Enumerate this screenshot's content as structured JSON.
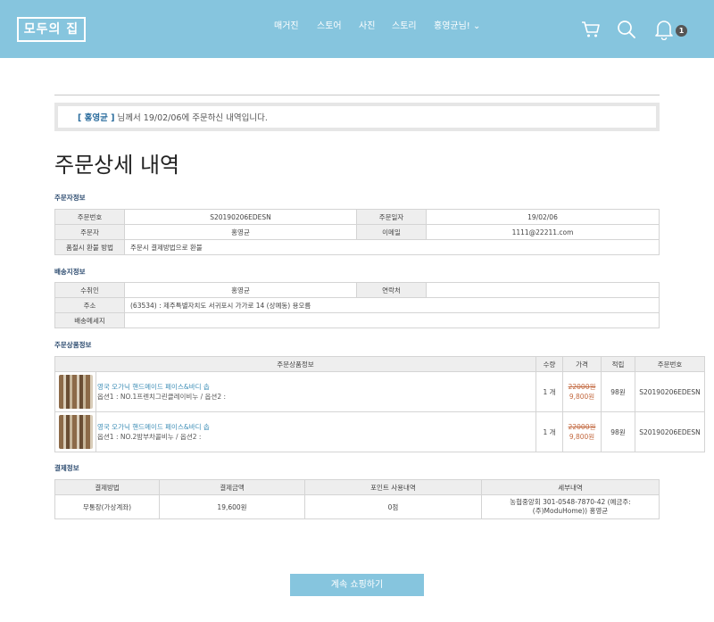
{
  "header": {
    "logo": "모두의 집",
    "nav": [
      "매거진",
      "스토어",
      "사진",
      "스토리",
      "홍영균님! ⌄"
    ],
    "notification_count": "1",
    "icons": [
      "cart-icon",
      "search-icon",
      "bell-icon"
    ]
  },
  "notice": {
    "name": "[ 홍영균 ]",
    "text": " 님께서 19/02/06에 주문하신 내역입니다."
  },
  "page_title": "주문상세 내역",
  "orderer": {
    "section": "주문자정보",
    "order_no_label": "주문번호",
    "order_no": "S20190206EDESN",
    "order_date_label": "주문일자",
    "order_date": "19/02/06",
    "orderer_label": "주문자",
    "orderer": "홍영균",
    "email_label": "이메일",
    "email": "1111@22211.com",
    "refund_label": "품절시 환불 방법",
    "refund": "주문시 결제방법으로 환불"
  },
  "shipping": {
    "section": "배송지정보",
    "recipient_label": "수취인",
    "recipient": "홍영균",
    "contact_label": "연락처",
    "contact": "",
    "address_label": "주소",
    "address": "(63534) : 제주특별자치도 서귀포시 가가로 14 (상예동) 용오름",
    "message_label": "배송메세지",
    "message": ""
  },
  "products": {
    "section": "주문상품정보",
    "headers": [
      "주문상품정보",
      "수량",
      "가격",
      "적립",
      "주문번호"
    ],
    "rows": [
      {
        "name": "영국 오가닉 핸드메이드 페이스&바디 솝",
        "option": "옵션1 : NO.1프렌치그린클레이비누 / 옵션2 :",
        "qty": "1 개",
        "orig_price": "22000원",
        "price": "9,800원",
        "points": "98원",
        "order_no": "S20190206EDESN"
      },
      {
        "name": "영국 오가닉 핸드메이드 페이스&바디 솝",
        "option": "옵션1 : NO.2밤부차콜비누 / 옵션2 :",
        "qty": "1 개",
        "orig_price": "22000원",
        "price": "9,800원",
        "points": "98원",
        "order_no": "S20190206EDESN"
      }
    ]
  },
  "payment": {
    "section": "결제정보",
    "headers": [
      "결제방법",
      "결제금액",
      "포인트 사용내역",
      "세부내역"
    ],
    "method": "무통장(가상계좌)",
    "amount": "19,600원",
    "points_used": "0점",
    "detail_line1": "농협중앙회 301-0548-7870-42 (예금주:",
    "detail_line2": "(주)ModuHome)) 홍영균"
  },
  "continue_button": "계속 쇼핑하기",
  "colors": {
    "brand": "#86c5de",
    "price": "#c2683f",
    "link": "#3f8fb7"
  }
}
